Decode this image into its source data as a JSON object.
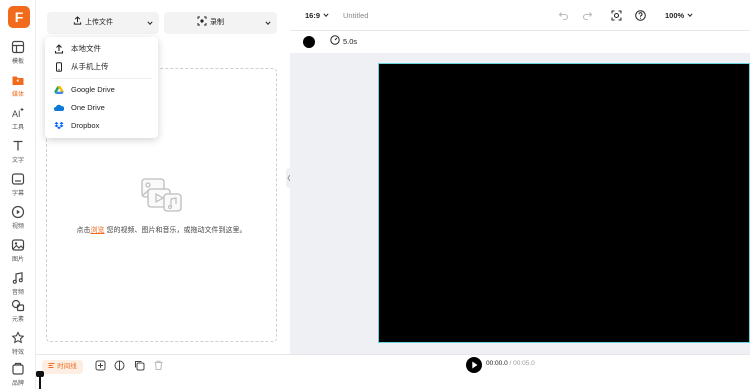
{
  "brand": {
    "logo_letter": "F",
    "accent": "#f26b1d"
  },
  "rail": {
    "items": [
      {
        "label": "模板",
        "icon": "template-icon"
      },
      {
        "label": "媒体",
        "icon": "media-icon",
        "active": true
      },
      {
        "label": "工具",
        "icon": "ai-tools-icon"
      },
      {
        "label": "文字",
        "icon": "text-icon"
      },
      {
        "label": "字幕",
        "icon": "subtitle-icon"
      },
      {
        "label": "视频",
        "icon": "video-icon"
      },
      {
        "label": "图片",
        "icon": "image-icon"
      },
      {
        "label": "音频",
        "icon": "music-icon"
      },
      {
        "label": "元素",
        "icon": "elements-icon"
      },
      {
        "label": "特效",
        "icon": "effects-icon"
      },
      {
        "label": "品牌",
        "icon": "brand-icon"
      }
    ]
  },
  "media": {
    "upload_label": "上传文件",
    "record_label": "录制",
    "upload_menu": [
      {
        "label": "本地文件",
        "icon": "upload-icon"
      },
      {
        "label": "从手机上传",
        "icon": "phone-icon"
      },
      {
        "label": "Google Drive",
        "icon": "google-drive-icon"
      },
      {
        "label": "One Drive",
        "icon": "onedrive-icon"
      },
      {
        "label": "Dropbox",
        "icon": "dropbox-icon"
      }
    ],
    "drop_prefix": "点击",
    "drop_link": "浏览",
    "drop_suffix": " 您的视频、图片和音乐，或拖动文件到这里。"
  },
  "topbar": {
    "aspect": "16:9",
    "title": "Untitled",
    "zoom": "100%"
  },
  "toolbar": {
    "bg_color": "#000000",
    "duration": "5.0s"
  },
  "timeline": {
    "button_label": "时间线",
    "current_time": "00:00.0",
    "separator": " / ",
    "total_time": "00:05.0"
  }
}
